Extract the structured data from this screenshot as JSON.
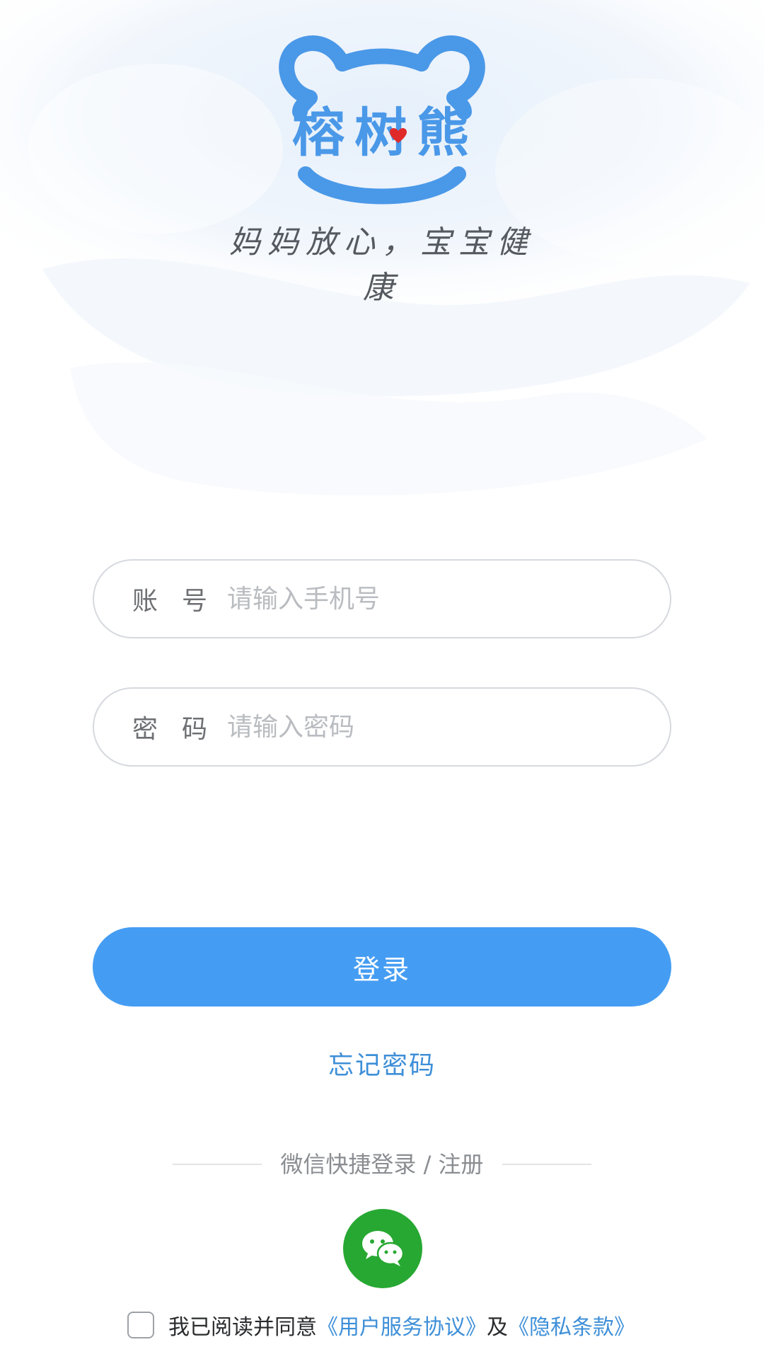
{
  "brand": {
    "logo_text": "榕树熊",
    "slogan": "妈妈放心，宝宝健康",
    "accent_color": "#4a98e8",
    "heart_color": "#e02a2a"
  },
  "form": {
    "account": {
      "label": "账号",
      "placeholder": "请输入手机号",
      "value": ""
    },
    "password": {
      "label": "密码",
      "placeholder": "请输入密码",
      "value": ""
    }
  },
  "login_button": {
    "label": "登录",
    "color": "#459df3"
  },
  "forgot_password": {
    "label": "忘记密码"
  },
  "wechat": {
    "divider_text": "微信快捷登录 / 注册",
    "icon": "wechat-icon",
    "color": "#27a832"
  },
  "agreement": {
    "checked": false,
    "prefix": "我已阅读并同意",
    "terms_link": "《用户服务协议》",
    "connector": "及",
    "privacy_link": "《隐私条款》"
  }
}
